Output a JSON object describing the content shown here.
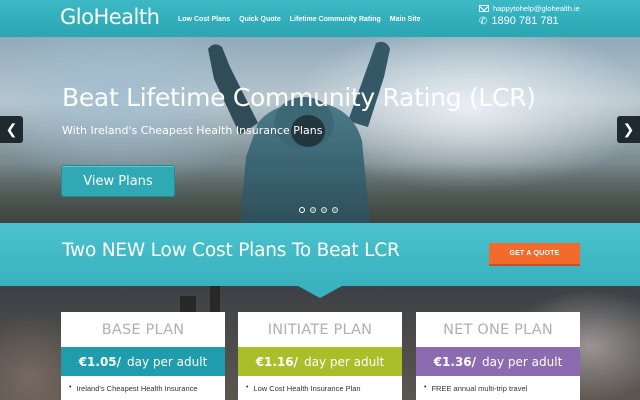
{
  "header": {
    "logo": "GloHealth",
    "nav": [
      "Low Cost Plans",
      "Quick Quote",
      "Lifetime Community Rating",
      "Main Site"
    ],
    "email": "happytohelp@glohealth.ie",
    "phone": "1890 781 781"
  },
  "hero": {
    "title": "Beat Lifetime Community Rating (LCR)",
    "subtitle": "With Ireland's Cheapest Health Insurance Plans",
    "button": "View Plans",
    "prev": "❮",
    "next": "❯",
    "slides_total": 4,
    "slide_active": 1
  },
  "band": {
    "title": "Two NEW Low Cost Plans To Beat LCR",
    "quote_button": "GET A QUOTE"
  },
  "plans": [
    {
      "name": "BASE PLAN",
      "price": "€1.05/",
      "unit": "day per adult",
      "feature": "Ireland's Cheapest Health Insurance",
      "color": "#1f9dad"
    },
    {
      "name": "INITIATE PLAN",
      "price": "€1.16/",
      "unit": "day per adult",
      "feature": "Low Cost Health Insurance Plan",
      "color": "#a9bf2a"
    },
    {
      "name": "NET ONE PLAN",
      "price": "€1.36/",
      "unit": "day per adult",
      "feature": "FREE annual multi-trip travel",
      "color": "#8b6cb1"
    }
  ],
  "colors": {
    "brand_teal": "#3db9c6",
    "cta_orange": "#f26a2c"
  },
  "icons": {
    "email": "mail-icon",
    "phone": "phone-icon",
    "prev": "chevron-left-icon",
    "next": "chevron-right-icon"
  }
}
